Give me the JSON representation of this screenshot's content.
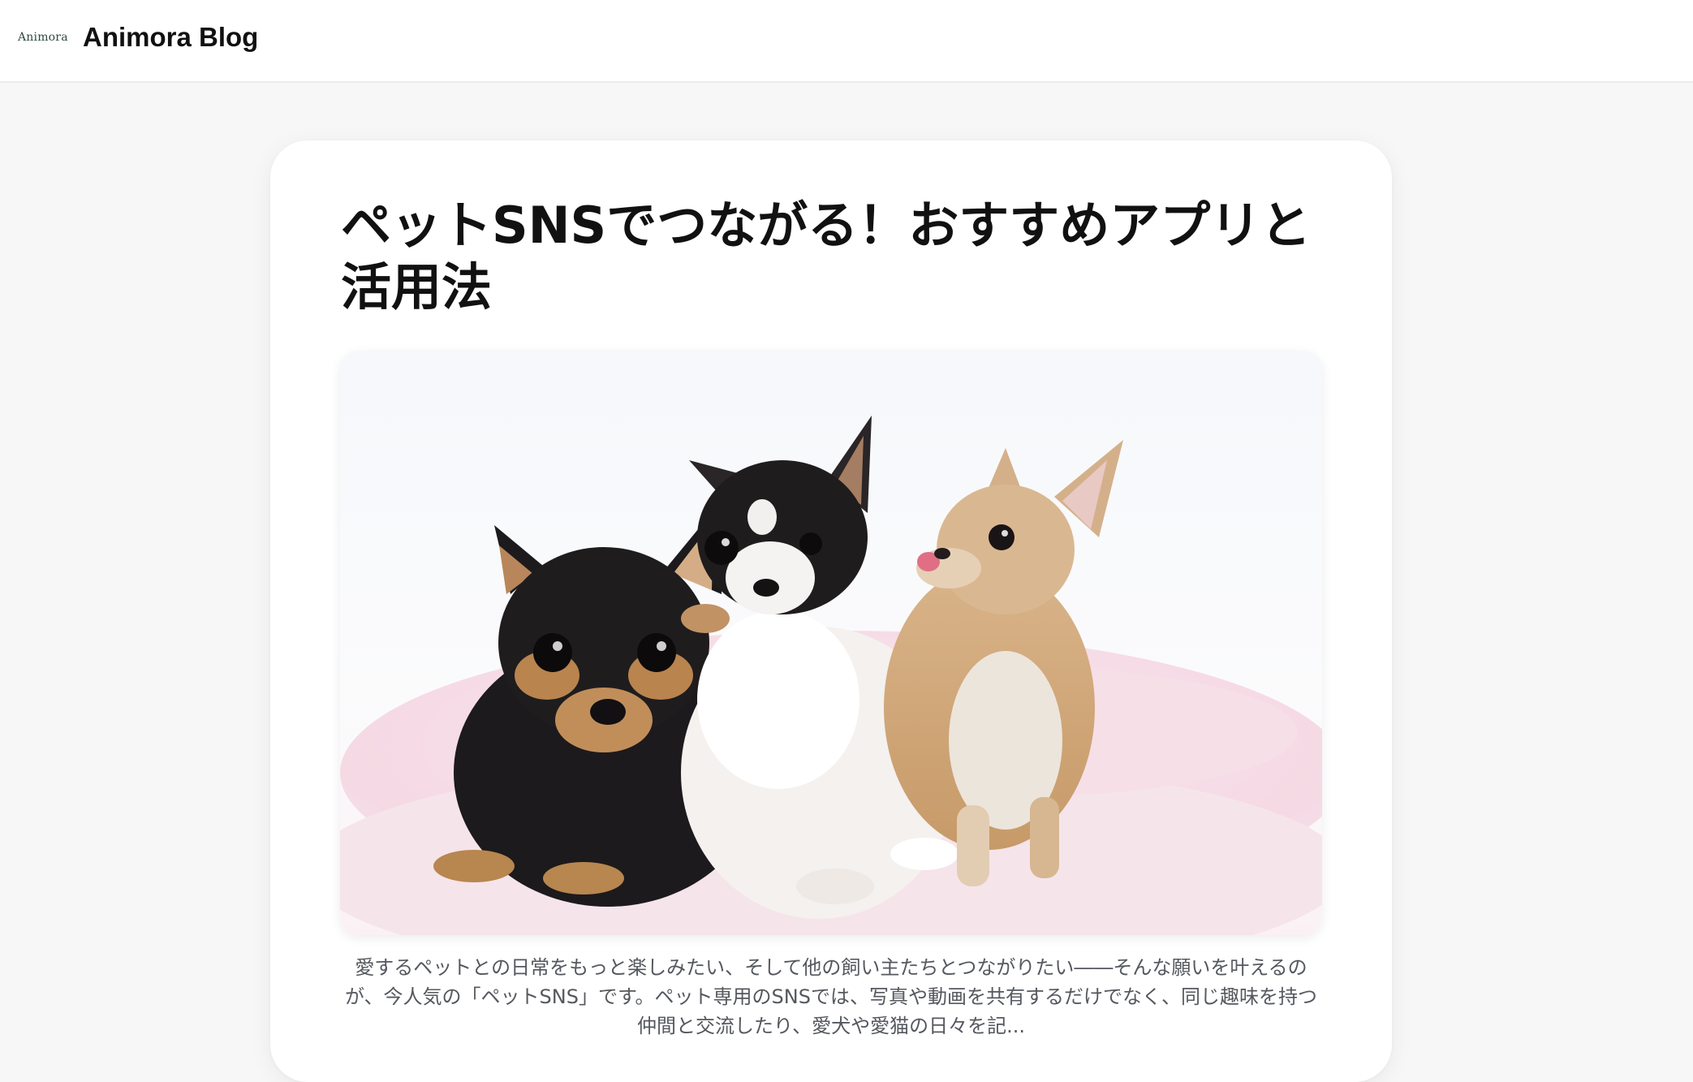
{
  "header": {
    "logo_text": "Animora",
    "site_title": "Animora Blog"
  },
  "article": {
    "title": "ペットSNSでつながる！おすすめアプリと活用法",
    "image_alt": "ピンクのベッドの上の3匹のチワワの子犬",
    "excerpt": "愛するペットとの日常をもっと楽しみたい、そして他の飼い主たちとつながりたい――そんな願いを叶えるのが、今人気の「ペットSNS」です。ペット専用のSNSでは、写真や動画を共有するだけでなく、同じ趣味を持つ仲間と交流したり、愛犬や愛猫の日々を記..."
  },
  "colors": {
    "page_bg": "#f7f7f8",
    "card_bg": "#ffffff",
    "title": "#111111",
    "excerpt": "#55585e",
    "bed_pink": "#f5d9e4"
  }
}
